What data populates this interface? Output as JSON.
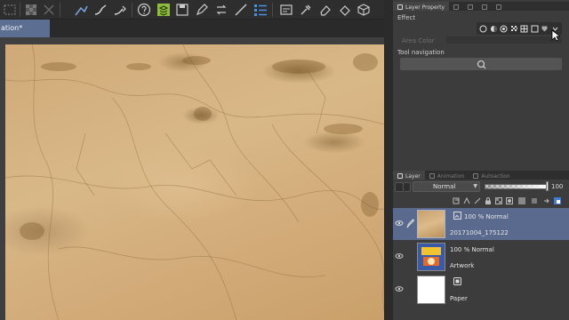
{
  "document": {
    "tab_title": "ation*"
  },
  "toolbar": {
    "icons": [
      "selection-icon",
      "checkerboard-icon",
      "transform-icon",
      "line-curve-icon",
      "line-correct-icon",
      "line-adjust-icon",
      "help-icon",
      "layer-stack-icon",
      "save-icon",
      "pen-icon",
      "ruler-icon",
      "list-icon",
      "window-icon",
      "eyedropper-icon",
      "eraser-icon",
      "cube-icon"
    ]
  },
  "layer_property": {
    "tab_label": "Layer Property",
    "effect_label": "Effect",
    "area_color_label": "Area Color",
    "tool_navigation_label": "Tool navigation"
  },
  "layer_panel": {
    "tabs": [
      "Layer",
      "Animation",
      "Autoaction"
    ],
    "blend_mode": "Normal",
    "opacity": "100",
    "layers": [
      {
        "status": "100 % Normal",
        "name": "20171004_175122",
        "selected": true,
        "thumb": "texture"
      },
      {
        "status": "100 % Normal",
        "name": "Artwork",
        "selected": false,
        "thumb": "artwork"
      },
      {
        "status": "",
        "name": "Paper",
        "selected": false,
        "thumb": "paper"
      }
    ]
  },
  "colors": {
    "accent": "#5a6a8e",
    "tab_active": "#5c6f92",
    "panel_bg": "#3c3c3c",
    "toolbar_bg": "#2e2e2e",
    "canvas_fill": "#d4ae7c"
  }
}
